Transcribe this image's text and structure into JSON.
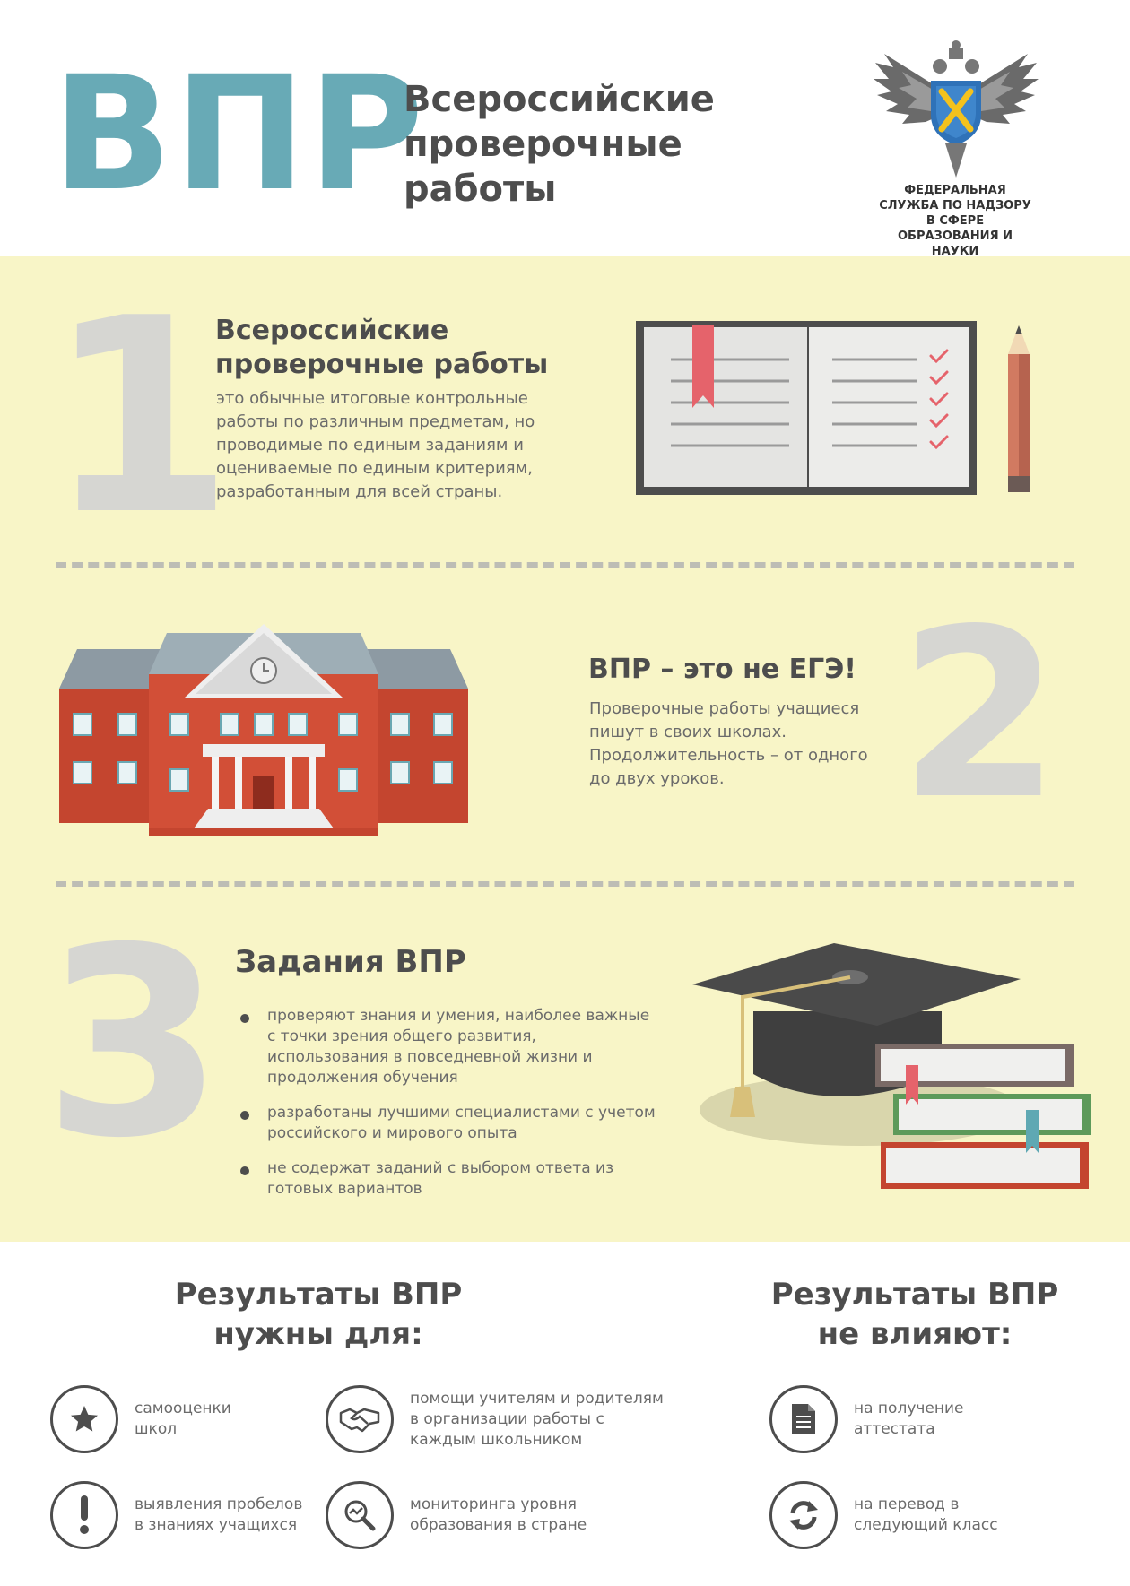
{
  "header": {
    "logo": "ВПР",
    "title": "Всероссийские проверочные работы",
    "agency": "ФЕДЕРАЛЬНАЯ СЛУЖБА ПО НАДЗОРУ В СФЕРЕ ОБРАЗОВАНИЯ И НАУКИ"
  },
  "sections": [
    {
      "number": "1",
      "title": "Всероссийские проверочные работы",
      "text": "это обычные итоговые контрольные работы по различным предметам, но проводимые по единым заданиям и оцениваемые по единым критериям, разработанным для всей страны."
    },
    {
      "number": "2",
      "title": "ВПР – это не ЕГЭ!",
      "text": "Проверочные работы учащиеся пишут в своих школах. Продолжительность – от одного до двух уроков."
    },
    {
      "number": "3",
      "title": "Задания ВПР",
      "bullets": [
        "проверяют знания и умения, наиболее важные с точки зрения общего развития, использования в повседневной жизни и продолжения обучения",
        "разработаны лучшими специалистами с учетом российского и мирового опыта",
        "не содержат заданий с выбором ответа из готовых вариантов"
      ]
    }
  ],
  "results": {
    "needed_title": "Результаты ВПР нужны для:",
    "not_affect_title": "Результаты ВПР не влияют:",
    "needed": [
      {
        "icon": "star-icon",
        "label": "самооценки школ"
      },
      {
        "icon": "exclamation-icon",
        "label": "выявления пробелов в знаниях учащихся"
      },
      {
        "icon": "handshake-icon",
        "label": "помощи учителям и родителям в организации работы с каждым школьником"
      },
      {
        "icon": "magnifier-chart-icon",
        "label": "мониторинга уровня образования в стране"
      }
    ],
    "not_affect": [
      {
        "icon": "document-icon",
        "label": "на получение аттестата"
      },
      {
        "icon": "refresh-icon",
        "label": "на перевод в следующий класс"
      }
    ]
  },
  "colors": {
    "accent": "#68aab6",
    "band": "#f8f5c7",
    "numbers": "#d6d6d2",
    "text_dark": "#4d4d4d",
    "brick": "#c4452f",
    "bookmark": "#e5636b"
  }
}
